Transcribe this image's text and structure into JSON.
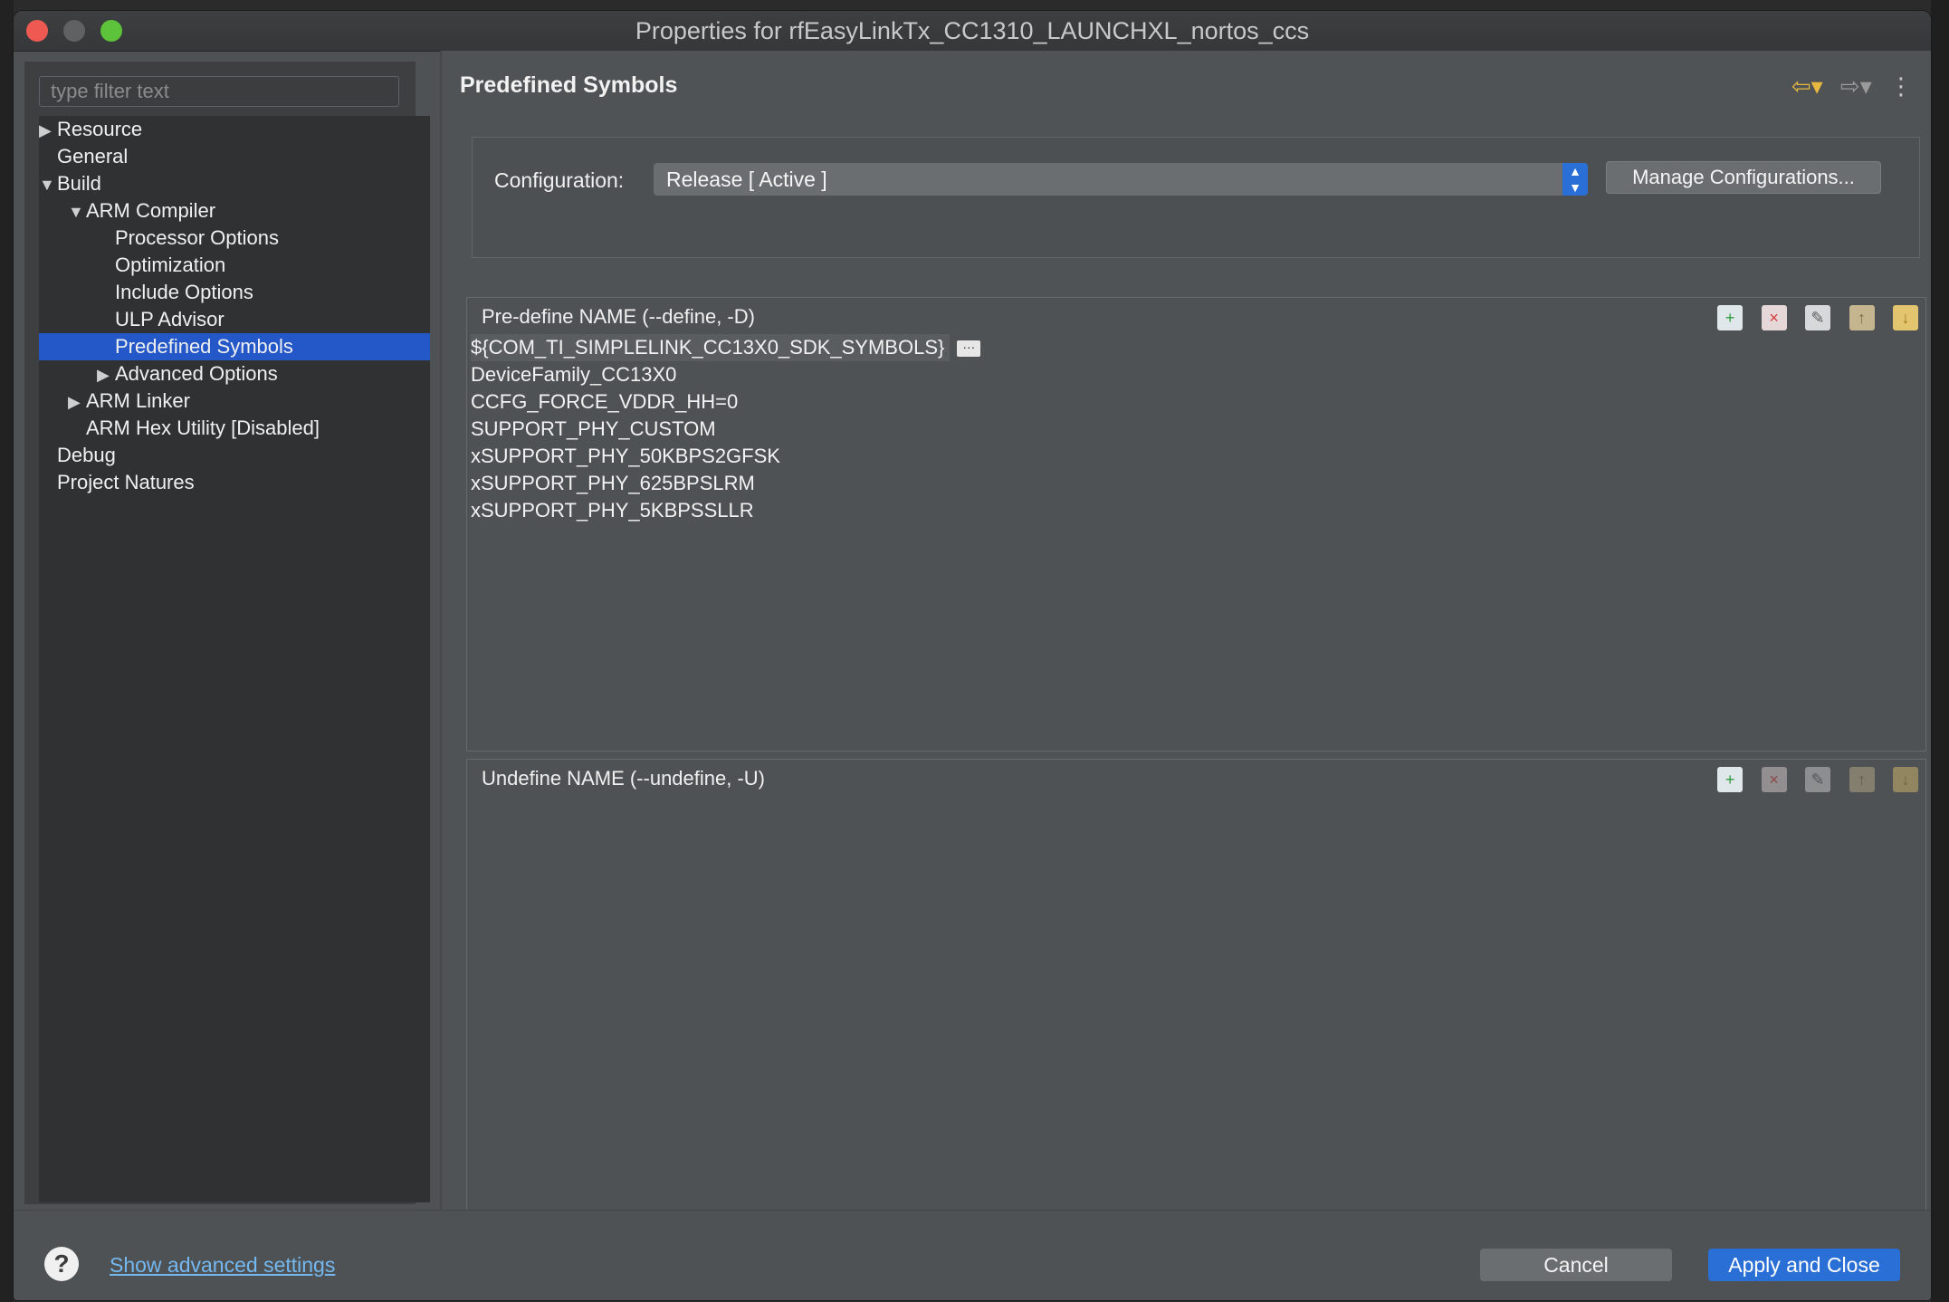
{
  "window": {
    "title": "Properties for rfEasyLinkTx_CC1310_LAUNCHXL_nortos_ccs"
  },
  "sidebar": {
    "filter_placeholder": "type filter text",
    "items": [
      {
        "label": "Resource",
        "expander": "collapsed"
      },
      {
        "label": "General",
        "expander": "none"
      },
      {
        "label": "Build",
        "expander": "expanded"
      },
      {
        "label": "ARM Compiler",
        "expander": "expanded"
      },
      {
        "label": "Processor Options",
        "expander": "none"
      },
      {
        "label": "Optimization",
        "expander": "none"
      },
      {
        "label": "Include Options",
        "expander": "none"
      },
      {
        "label": "ULP Advisor",
        "expander": "none"
      },
      {
        "label": "Predefined Symbols",
        "expander": "none",
        "selected": true
      },
      {
        "label": "Advanced Options",
        "expander": "collapsed"
      },
      {
        "label": "ARM Linker",
        "expander": "collapsed"
      },
      {
        "label": "ARM Hex Utility  [Disabled]",
        "expander": "none"
      },
      {
        "label": "Debug",
        "expander": "none"
      },
      {
        "label": "Project Natures",
        "expander": "none"
      }
    ]
  },
  "main": {
    "title": "Predefined Symbols",
    "nav": {
      "back_icon": "arrow-left-icon",
      "forward_icon": "arrow-right-icon",
      "menu_icon": "more-vertical-icon"
    },
    "configuration": {
      "label": "Configuration:",
      "value": "Release  [ Active ]",
      "manage_button": "Manage Configurations..."
    },
    "predefine": {
      "title": "Pre-define NAME (--define, -D)",
      "items": [
        "${COM_TI_SIMPLELINK_CC13X0_SDK_SYMBOLS}",
        "DeviceFamily_CC13X0",
        "CCFG_FORCE_VDDR_HH=0",
        "SUPPORT_PHY_CUSTOM",
        "xSUPPORT_PHY_50KBPS2GFSK",
        "xSUPPORT_PHY_625BPSLRM",
        "xSUPPORT_PHY_5KBPSSLLR"
      ],
      "ellipsis": "···"
    },
    "undefine": {
      "title": "Undefine NAME (--undefine, -U)",
      "items": []
    }
  },
  "footer": {
    "help_icon": "?",
    "advanced_link": "Show advanced settings",
    "cancel_label": "Cancel",
    "apply_label": "Apply and Close"
  },
  "colors": {
    "accent": "#2a6fd6",
    "selection": "#2458c8",
    "link": "#74b8ef"
  }
}
